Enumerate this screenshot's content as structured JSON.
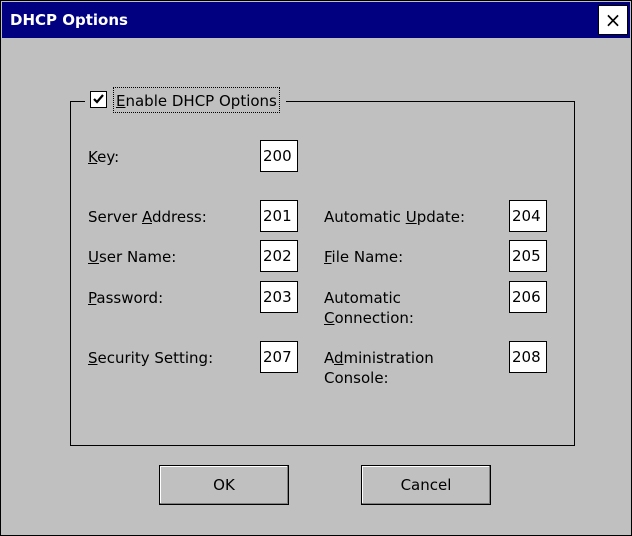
{
  "dialog": {
    "title": "DHCP Options",
    "close_glyph": "×"
  },
  "enable": {
    "checked": true,
    "mnemonic": "E",
    "rest": "nable DHCP Options"
  },
  "key": {
    "mnemonic": "K",
    "rest": "ey:",
    "value": "200"
  },
  "server_address": {
    "pre": "Server ",
    "mnemonic": "A",
    "rest": "ddress:",
    "value": "201"
  },
  "user_name": {
    "mnemonic": "U",
    "rest": "ser Name:",
    "value": "202"
  },
  "password": {
    "mnemonic": "P",
    "rest": "assword:",
    "value": "203"
  },
  "security_setting": {
    "mnemonic": "S",
    "rest": "ecurity Setting:",
    "value": "207"
  },
  "automatic_update": {
    "pre": "Automatic ",
    "mnemonic": "U",
    "rest": "pdate:",
    "value": "204"
  },
  "file_name": {
    "mnemonic": "F",
    "rest": "ile Name:",
    "value": "205"
  },
  "automatic_connection": {
    "line1": "Automatic",
    "mnemonic": "C",
    "rest": "onnection:",
    "value": "206"
  },
  "administration_console": {
    "pre": "A",
    "mnemonic": "d",
    "rest": "ministration",
    "line2": "Console:",
    "value": "208"
  },
  "buttons": {
    "ok": "OK",
    "cancel": "Cancel"
  }
}
